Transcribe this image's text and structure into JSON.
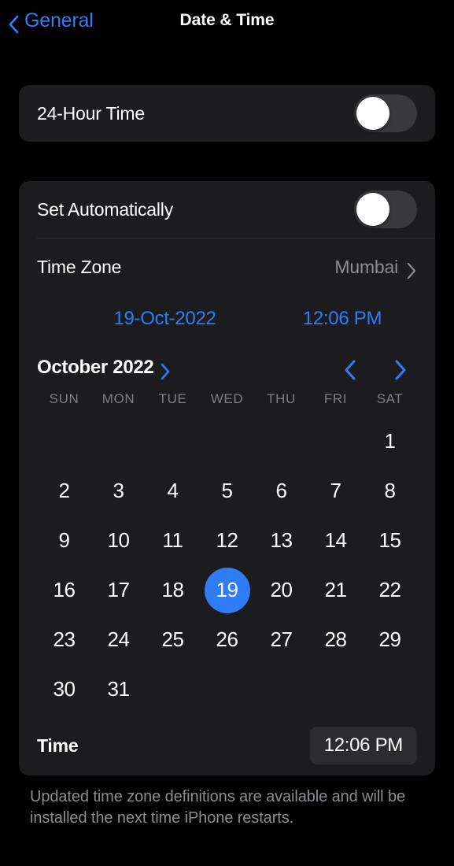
{
  "nav": {
    "back_label": "General",
    "back_icon": "chevron-left-icon",
    "title": "Date & Time"
  },
  "hour_format": {
    "label": "24-Hour Time",
    "toggle_on": false
  },
  "auto": {
    "label": "Set Automatically",
    "toggle_on": false
  },
  "time_zone": {
    "label": "Time Zone",
    "value": "Mumbai",
    "chevron_icon": "chevron-right-icon"
  },
  "quick_display": {
    "date": "19-Oct-2022",
    "time": "12:06 PM"
  },
  "calendar": {
    "month_label": "October 2022",
    "month_chevron_icon": "chevron-right-icon",
    "prev_icon": "chevron-left-icon",
    "next_icon": "chevron-right-icon",
    "weekdays": [
      "SUN",
      "MON",
      "TUE",
      "WED",
      "THU",
      "FRI",
      "SAT"
    ],
    "lead_blanks": 6,
    "days": [
      1,
      2,
      3,
      4,
      5,
      6,
      7,
      8,
      9,
      10,
      11,
      12,
      13,
      14,
      15,
      16,
      17,
      18,
      19,
      20,
      21,
      22,
      23,
      24,
      25,
      26,
      27,
      28,
      29,
      30,
      31
    ],
    "selected_day": 19
  },
  "time_row": {
    "label": "Time",
    "value": "12:06 PM"
  },
  "footer": {
    "text": "Updated time zone definitions are available and will be installed the next time iPhone restarts."
  },
  "colors": {
    "background": "#000000",
    "card": "#1c1c1e",
    "accent": "#2f7cf6",
    "secondary_text": "#8d8d92",
    "toggle_track_off": "#39393d",
    "pill": "#2c2c2e"
  }
}
